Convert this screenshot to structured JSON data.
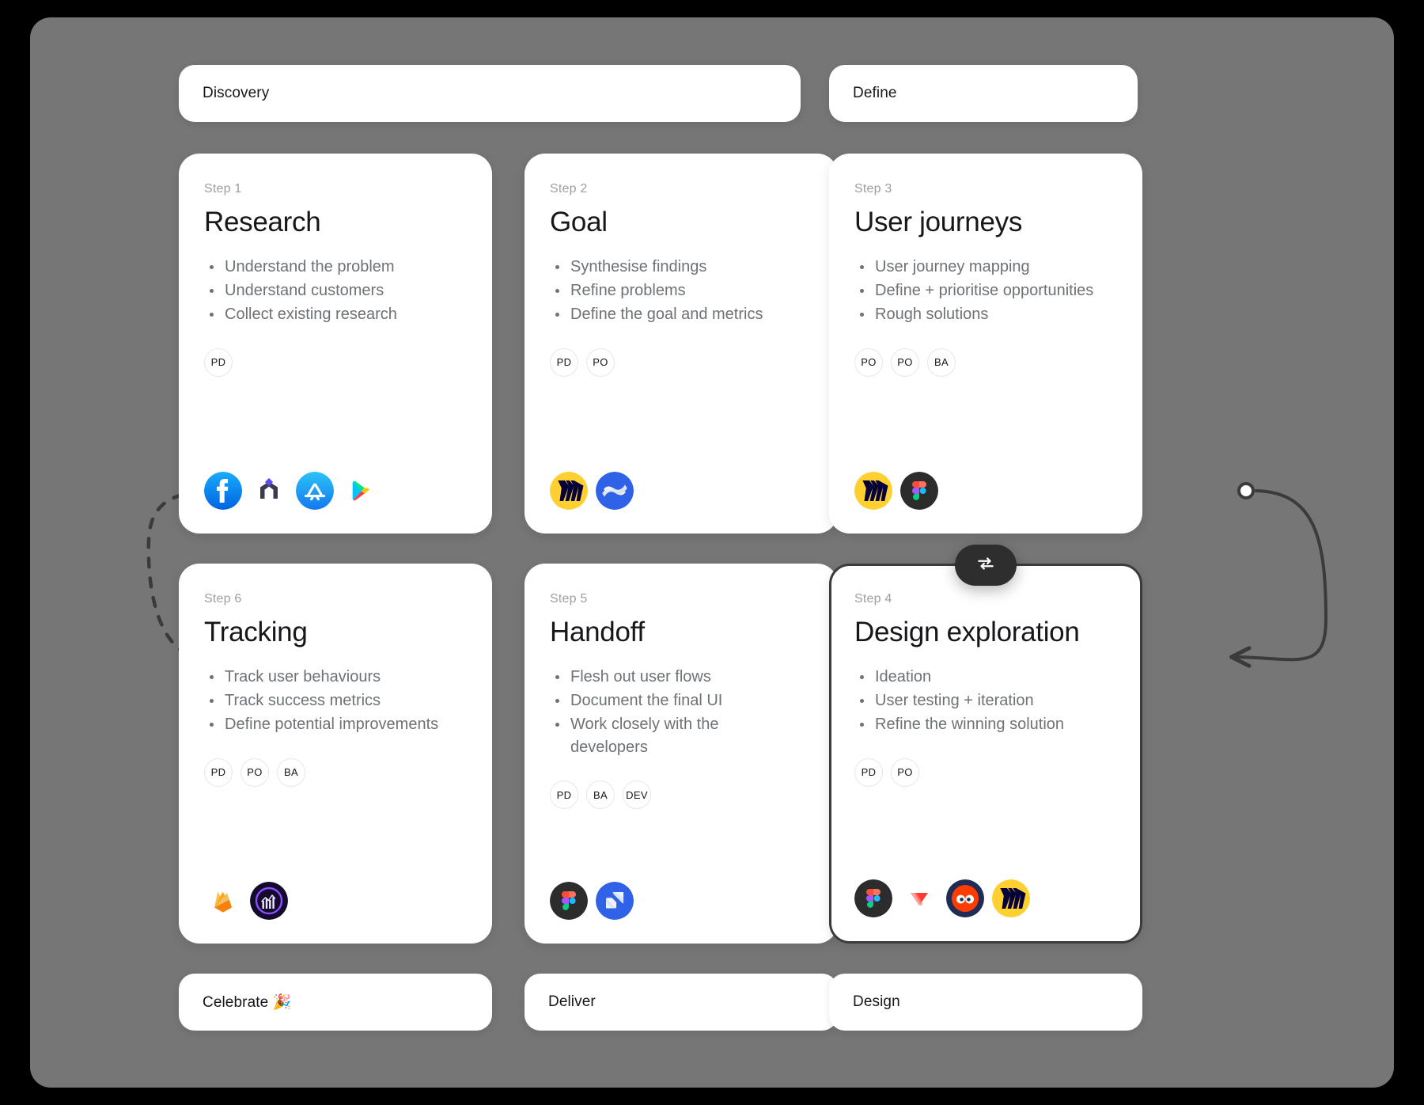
{
  "board": {
    "background_color": "#767676",
    "card_background": "#ffffff",
    "selected_border_color": "#3b3b3b"
  },
  "phases": [
    {
      "label": "Discovery"
    },
    {
      "label": "Define"
    },
    {
      "label": "Celebrate 🎉"
    },
    {
      "label": "Deliver"
    },
    {
      "label": "Design"
    }
  ],
  "cards": [
    {
      "step": "Step 1",
      "title": "Research",
      "bullets": [
        "Understand the problem",
        "Understand customers",
        "Collect existing research"
      ],
      "roles": [
        "PD"
      ],
      "apps": [
        "facebook-icon",
        "maze-icon",
        "app-store-icon",
        "google-play-icon"
      ]
    },
    {
      "step": "Step 2",
      "title": "Goal",
      "bullets": [
        "Synthesise findings",
        "Refine problems",
        "Define the goal and metrics"
      ],
      "roles": [
        "PD",
        "PO"
      ],
      "apps": [
        "miro-icon",
        "confluence-icon"
      ]
    },
    {
      "step": "Step 3",
      "title": "User journeys",
      "bullets": [
        "User journey mapping",
        "Define + prioritise opportunities",
        "Rough solutions"
      ],
      "roles": [
        "PO",
        "PO",
        "BA"
      ],
      "apps": [
        "miro-icon",
        "figma-icon"
      ]
    },
    {
      "step": "Step 6",
      "title": "Tracking",
      "bullets": [
        "Track user behaviours",
        "Track success metrics",
        "Define potential improvements"
      ],
      "roles": [
        "PD",
        "PO",
        "BA"
      ],
      "apps": [
        "firebase-icon",
        "amplitude-icon"
      ]
    },
    {
      "step": "Step 5",
      "title": "Handoff",
      "bullets": [
        "Flesh out user flows",
        "Document the final UI",
        "Work closely with the developers"
      ],
      "roles": [
        "PD",
        "BA",
        "DEV"
      ],
      "apps": [
        "figma-icon",
        "jira-icon"
      ]
    },
    {
      "step": "Step 4",
      "title": "Design exploration",
      "bullets": [
        "Ideation",
        "User testing + iteration",
        "Refine the winning solution"
      ],
      "roles": [
        "PD",
        "PO"
      ],
      "apps": [
        "figma-icon",
        "principle-icon",
        "hotjar-icon",
        "miro-icon"
      ],
      "selected": true
    }
  ],
  "loop_button": {
    "icon": "loop-repeat-icon",
    "background_color": "#2e2e2e"
  }
}
